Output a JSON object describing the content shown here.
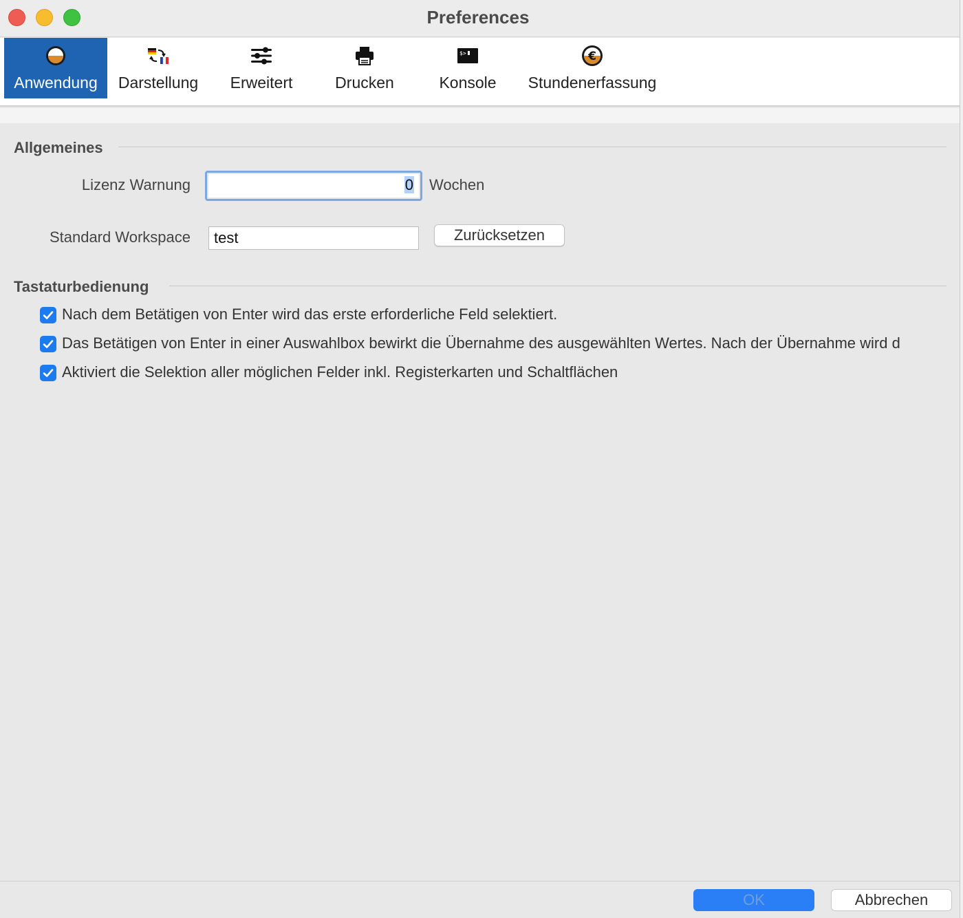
{
  "window": {
    "title": "Preferences"
  },
  "toolbar": {
    "tabs": [
      {
        "label": "Anwendung",
        "icon": "app-toggle-icon",
        "active": true
      },
      {
        "label": "Darstellung",
        "icon": "language-flags-icon",
        "active": false
      },
      {
        "label": "Erweitert",
        "icon": "sliders-icon",
        "active": false
      },
      {
        "label": "Drucken",
        "icon": "printer-icon",
        "active": false
      },
      {
        "label": "Konsole",
        "icon": "terminal-icon",
        "active": false
      },
      {
        "label": "Stundenerfassung",
        "icon": "euro-coin-icon",
        "active": false
      }
    ]
  },
  "general": {
    "heading": "Allgemeines",
    "license_warning": {
      "label": "Lizenz Warnung",
      "value": "0",
      "unit": "Wochen"
    },
    "default_workspace": {
      "label": "Standard Workspace",
      "value": "test",
      "reset_label": "Zurücksetzen"
    }
  },
  "keyboard": {
    "heading": "Tastaturbedienung",
    "options": [
      {
        "label": "Nach dem Betätigen von Enter wird das erste erforderliche Feld selektiert.",
        "checked": true
      },
      {
        "label": "Das Betätigen von Enter in einer Auswahlbox bewirkt die Übernahme des ausgewählten Wertes. Nach der Übernahme wird d",
        "checked": true
      },
      {
        "label": "Aktiviert die Selektion aller möglichen Felder inkl. Registerkarten und Schaltflächen",
        "checked": true
      }
    ]
  },
  "footer": {
    "ok_label": "OK",
    "cancel_label": "Abbrechen"
  },
  "colors": {
    "accent": "#1f64b3",
    "checkbox": "#1d7bf0",
    "ok_button": "#2b7ff6"
  }
}
